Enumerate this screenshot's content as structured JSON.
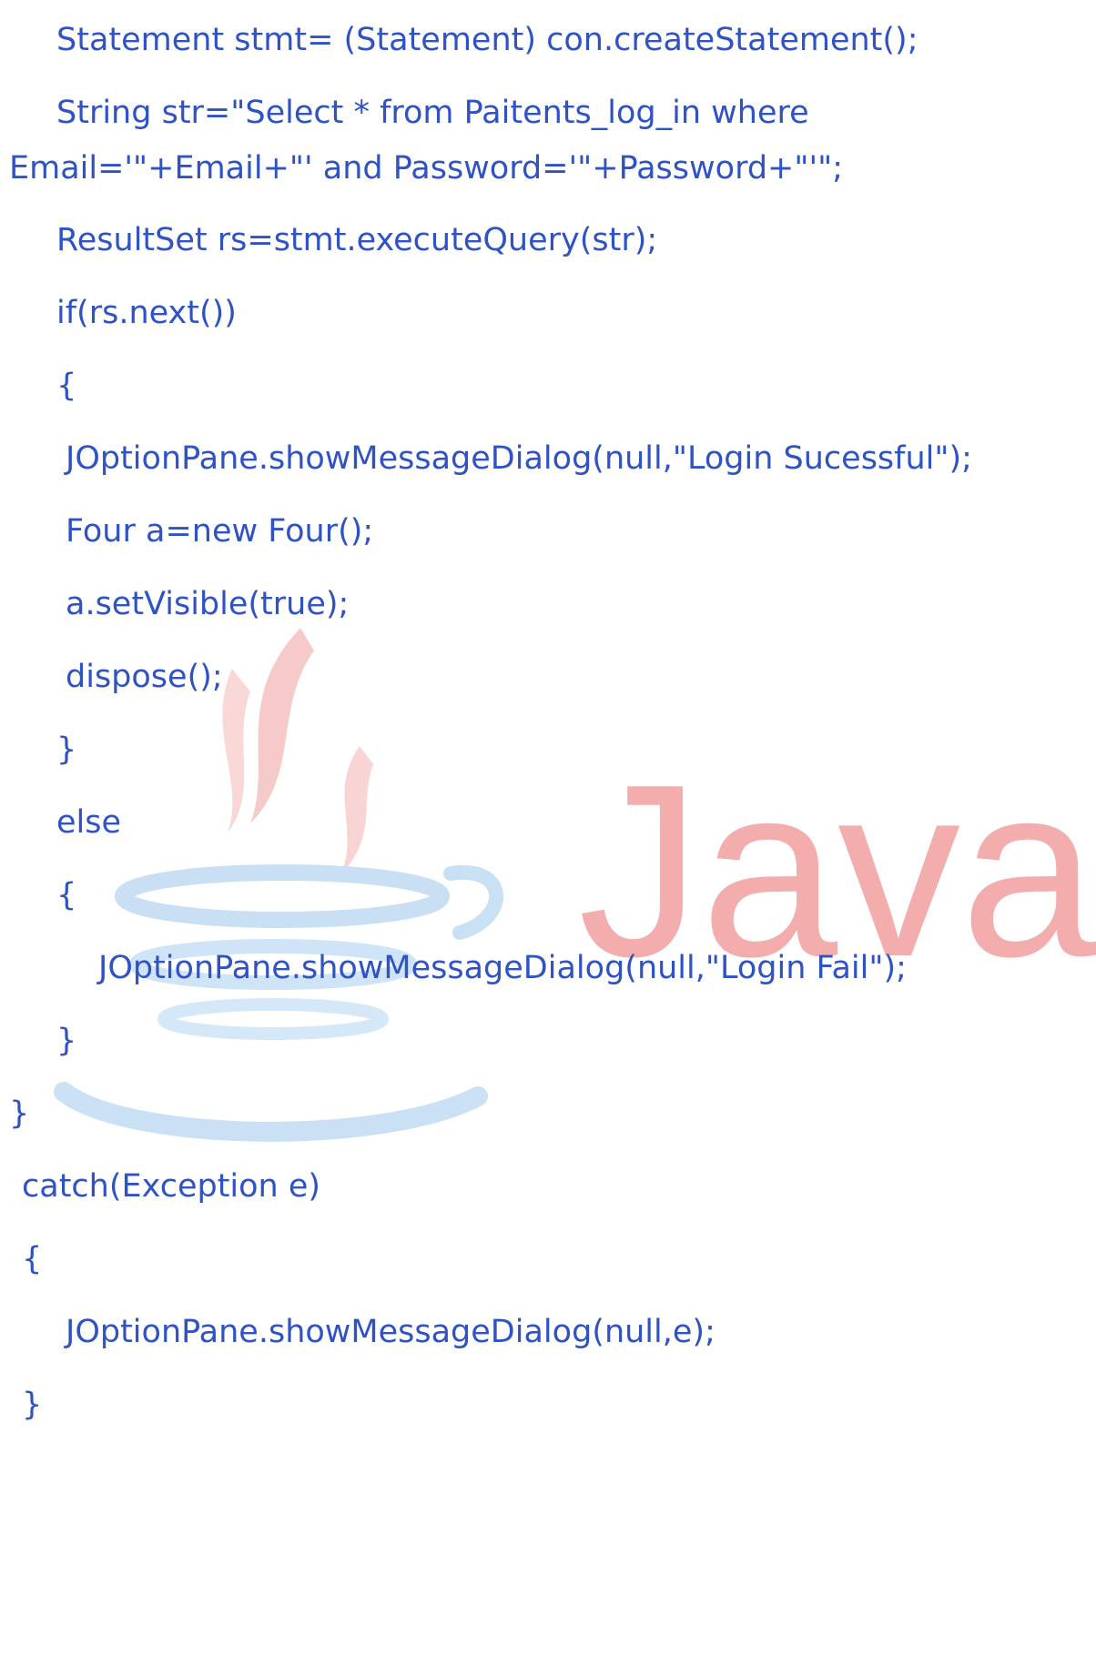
{
  "code": {
    "lines": [
      "Statement stmt= (Statement) con.createStatement();",
      "String str=\"Select * from Paitents_log_in where",
      "Email='\"+Email+\"' and Password='\"+Password+\"'\";",
      "ResultSet rs=stmt.executeQuery(str);",
      "if(rs.next())",
      "{",
      "JOptionPane.showMessageDialog(null,\"Login Sucessful\");",
      "Four a=new Four();",
      "a.setVisible(true);",
      "dispose();",
      "}",
      "else",
      "{",
      "JOptionPane.showMessageDialog(null,\"Login Fail\");",
      "}",
      "}",
      "catch(Exception e)",
      "{",
      "JOptionPane.showMessageDialog(null,e);",
      "}"
    ]
  },
  "watermark": {
    "icon": "java-coffee-cup-icon",
    "wordmark": "Java",
    "brand_red": "#e76f51",
    "brand_blue": "#5b9bd5"
  },
  "colors": {
    "code_text": "#2f52c4",
    "background": "#ffffff"
  }
}
